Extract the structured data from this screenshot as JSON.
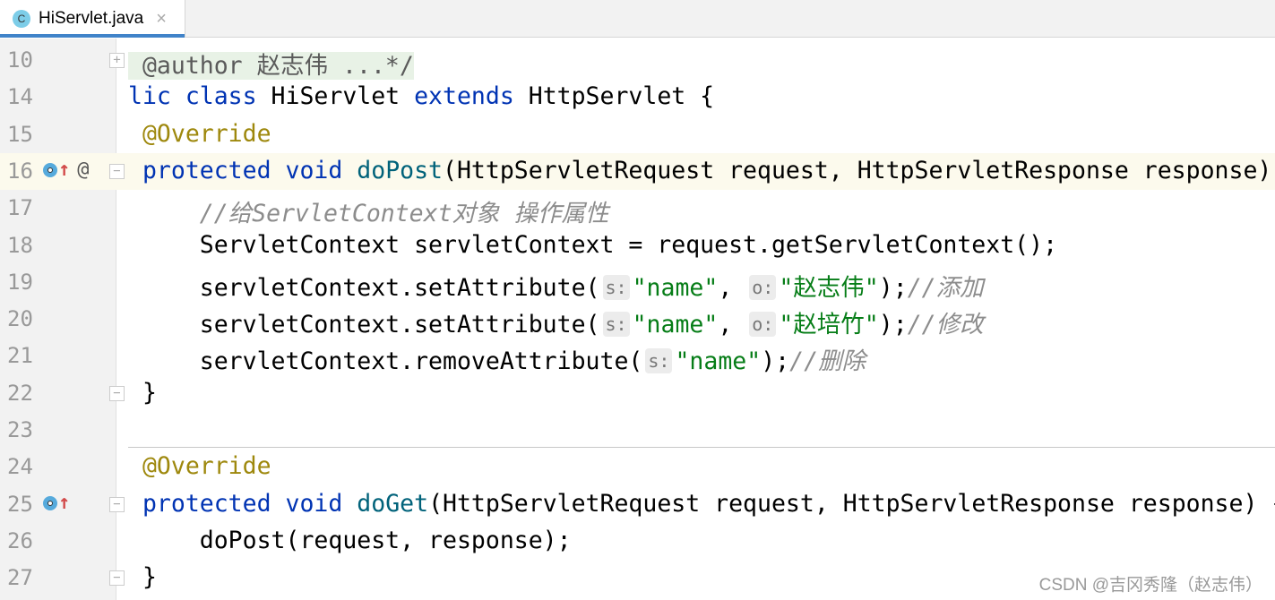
{
  "tab": {
    "icon": "class-icon",
    "icon_letter": "C",
    "title": "HiServlet.java",
    "close": "×"
  },
  "lines": [
    {
      "n": "10",
      "fold": "+",
      "tokens": [
        {
          "t": " @author 赵志伟 ...*/",
          "c": "doc fold10"
        }
      ]
    },
    {
      "n": "14",
      "tokens": [
        {
          "t": "lic class ",
          "c": "kw"
        },
        {
          "t": "HiServlet ",
          "c": ""
        },
        {
          "t": "extends ",
          "c": "kw"
        },
        {
          "t": "HttpServlet {",
          "c": ""
        }
      ]
    },
    {
      "n": "15",
      "tokens": [
        {
          "t": " @Override",
          "c": "ann"
        }
      ]
    },
    {
      "n": "16",
      "cur": true,
      "icons": true,
      "at": true,
      "fold": "−",
      "tokens": [
        {
          "t": " protected void ",
          "c": "kw"
        },
        {
          "t": "doPost",
          "c": "fn"
        },
        {
          "t": "(HttpServletRequest request, HttpServletResponse response)",
          "c": ""
        }
      ]
    },
    {
      "n": "17",
      "tokens": [
        {
          "t": "     //给ServletContext对象 操作属性",
          "c": "cmt"
        }
      ]
    },
    {
      "n": "18",
      "tokens": [
        {
          "t": "     ServletContext servletContext = request.getServletContext();",
          "c": ""
        }
      ]
    },
    {
      "n": "19",
      "tokens": [
        {
          "t": "     servletContext.setAttribute(",
          "c": ""
        },
        {
          "t": "s:",
          "c": "hint"
        },
        {
          "t": "\"name\"",
          "c": "str"
        },
        {
          "t": ", ",
          "c": ""
        },
        {
          "t": "o:",
          "c": "hint"
        },
        {
          "t": "\"赵志伟\"",
          "c": "str"
        },
        {
          "t": ");",
          "c": ""
        },
        {
          "t": "//添加",
          "c": "cmt"
        }
      ]
    },
    {
      "n": "20",
      "tokens": [
        {
          "t": "     servletContext.setAttribute(",
          "c": ""
        },
        {
          "t": "s:",
          "c": "hint"
        },
        {
          "t": "\"name\"",
          "c": "str"
        },
        {
          "t": ", ",
          "c": ""
        },
        {
          "t": "o:",
          "c": "hint"
        },
        {
          "t": "\"赵培竹\"",
          "c": "str"
        },
        {
          "t": ");",
          "c": ""
        },
        {
          "t": "//修改",
          "c": "cmt"
        }
      ]
    },
    {
      "n": "21",
      "tokens": [
        {
          "t": "     servletContext.removeAttribute(",
          "c": ""
        },
        {
          "t": "s:",
          "c": "hint"
        },
        {
          "t": "\"name\"",
          "c": "str"
        },
        {
          "t": ");",
          "c": ""
        },
        {
          "t": "//删除",
          "c": "cmt"
        }
      ]
    },
    {
      "n": "22",
      "fold": "−",
      "tokens": [
        {
          "t": " }",
          "c": ""
        }
      ]
    },
    {
      "n": "23",
      "tokens": []
    },
    {
      "n": "24",
      "tokens": [
        {
          "t": " @Override",
          "c": "ann"
        }
      ]
    },
    {
      "n": "25",
      "icons": true,
      "fold": "−",
      "tokens": [
        {
          "t": " protected void ",
          "c": "kw"
        },
        {
          "t": "doGet",
          "c": "fn"
        },
        {
          "t": "(HttpServletRequest request, HttpServletResponse response) {",
          "c": ""
        }
      ]
    },
    {
      "n": "26",
      "tokens": [
        {
          "t": "     doPost(request, response);",
          "c": ""
        }
      ]
    },
    {
      "n": "27",
      "fold": "−",
      "tokens": [
        {
          "t": " }",
          "c": ""
        }
      ]
    }
  ],
  "watermark": "CSDN @吉冈秀隆（赵志伟）"
}
